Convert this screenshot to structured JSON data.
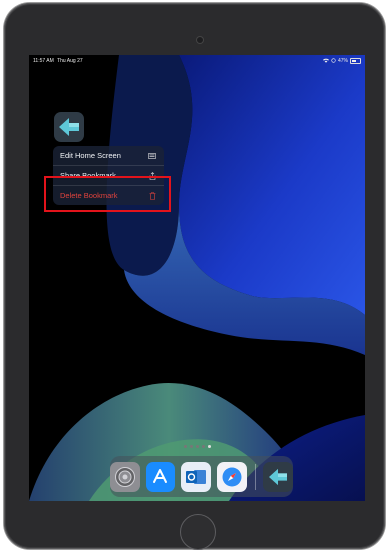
{
  "status_bar": {
    "time": "11:57 AM",
    "date": "Thu Aug 27",
    "battery": "47%"
  },
  "home_screen_app": {
    "icon": "bookmark-arrow-icon"
  },
  "context_menu": {
    "items": [
      {
        "label": "Edit Home Screen",
        "icon": "keyboard-icon",
        "destructive": false
      },
      {
        "label": "Share Bookmark",
        "icon": "share-icon",
        "destructive": false
      },
      {
        "label": "Delete Bookmark",
        "icon": "trash-icon",
        "destructive": true
      }
    ]
  },
  "page_indicator": {
    "pages": 5,
    "active_index": 4
  },
  "dock": {
    "apps": [
      {
        "name": "settings-icon"
      },
      {
        "name": "app-store-icon"
      },
      {
        "name": "outlook-icon"
      },
      {
        "name": "safari-icon"
      },
      {
        "name": "bookmark-arrow-icon"
      }
    ]
  },
  "colors": {
    "highlight": "#e3131b",
    "destructive": "#e0433d",
    "wallpaper_blue": "#1b3ac8"
  }
}
